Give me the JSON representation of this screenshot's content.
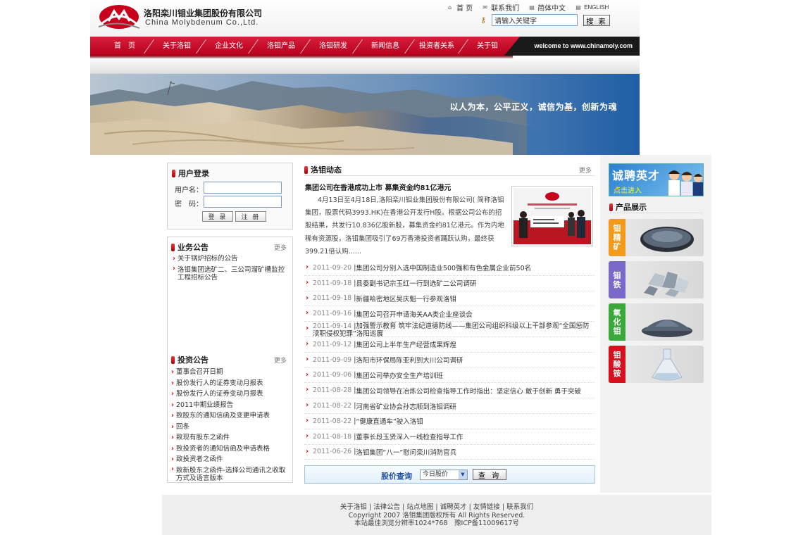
{
  "header": {
    "company_cn": "洛阳栾川钼业集团股份有限公司",
    "company_en": "China Molybdenum Co.,Ltd.",
    "top_links": {
      "home": "首 页",
      "contact": "联系我们",
      "simplified": "简体中文",
      "english": "ENGLISH"
    },
    "search": {
      "value": "请输入关键字",
      "button": "搜 索"
    }
  },
  "nav": {
    "items": [
      "首　页",
      "关于洛钼",
      "企业文化",
      "洛钼产品",
      "洛钼研发",
      "新闻信息",
      "投资者关系",
      "关于钼"
    ],
    "welcome": "welcome to www.chinamoly.com"
  },
  "banner": {
    "slogan": "以人为本，公平正义，诚信为基，创新为魂"
  },
  "login": {
    "title": "用户登录",
    "username_label": "用户名：",
    "password_label": "密　码：",
    "login_button": "登 录",
    "register_button": "注 册"
  },
  "business_notice": {
    "title": "业务公告",
    "more": "更多",
    "items": [
      "关于锅炉招标的公告",
      "洛钼集团选矿二、三公司溜矿槽监控工程招标公告"
    ]
  },
  "investor_notice": {
    "title": "投资公告",
    "more": "更多",
    "items": [
      "董事会召开日期",
      "股份发行人的证券变动月报表",
      "股份发行人的证券变动月报表",
      "2011中期业绩报告",
      "致股东的通知信函及变更申请表",
      "回条",
      "致现有股东之函件",
      "致投资者的通知信函及申请表格",
      "致投资者之函件",
      "致新股东之函件-选择公司通讯之收取方式及语言版本"
    ]
  },
  "news": {
    "title": "洛钼动态",
    "more": "更多",
    "headline": "集团公司在香港成功上市 募集资金约81亿港元",
    "summary": "4月13日至4月18日,洛阳栾川钼业集团股份有限公司( 简称洛钼集团，股票代码3993.HK)在香港公开发行H股。根据公司公布的招股结果，共发行10.836亿股新股，募集资金约81亿港元。作为内地稀有资源股，洛钼集团吸引了69万香港投资者踊跃认购，最终获399.21倍认购......",
    "items": [
      {
        "date": "2011-09-20",
        "text": "集团公司分别入选中国制造业500强和有色金属企业前50名"
      },
      {
        "date": "2011-09-18",
        "text": "县委副书记宗玉红一行到选矿二公司调研"
      },
      {
        "date": "2011-09-18",
        "text": "新疆哈密地区吴庆魁一行参观洛钼"
      },
      {
        "date": "2011-09-16",
        "text": "集团公司召开申请海关AA类企业座谈会"
      },
      {
        "date": "2011-09-14",
        "text": "加强警示教育 筑牢法纪道德防线——集团公司组织科级以上干部参观“全国惩防渎职侵权犯罪”洛阳巡展"
      },
      {
        "date": "2011-09-12",
        "text": "集团公司上半年生产经营成果辉煌"
      },
      {
        "date": "2011-09-09",
        "text": "洛阳市环保局陈亚利到大川公司调研"
      },
      {
        "date": "2011-09-06",
        "text": "集团公司举办安全生产培训班"
      },
      {
        "date": "2011-08-28",
        "text": "集团公司领导在冶炼公司检查指导工作时指出：坚定信心 敢于创新 勇于突破"
      },
      {
        "date": "2011-08-22",
        "text": "河南省矿业协会孙志顺到洛钼调研"
      },
      {
        "date": "2011-08-22",
        "text": "“健康直通车”驶入洛钼"
      },
      {
        "date": "2011-08-18",
        "text": "董事长段玉贤深入一线检查指导工作"
      },
      {
        "date": "2011-06-26",
        "text": "洛钼集团“八一”慰问栾川消防官兵"
      }
    ]
  },
  "stock": {
    "label": "股价查询",
    "select_value": "今日股价",
    "button": "查 询"
  },
  "recruit": {
    "big": "诚聘英才",
    "small": "点击进入"
  },
  "products": {
    "title": "产品展示",
    "items": [
      {
        "name": "钼精矿",
        "color": "#f39a1a"
      },
      {
        "name": "钼铁",
        "color": "#7a69c8"
      },
      {
        "name": "氧化钼",
        "color": "#3aa83a"
      },
      {
        "name": "钼酸铵",
        "color": "#d8101e"
      }
    ]
  },
  "footer": {
    "links": "关于洛钼 | 法律公告 | 站点地图 | 诚聘英才 | 友情链接 | 联系我们",
    "copyright": "Copyright 2007 洛钼集团版权所有 All Rights Reserved.",
    "info": "本站最佳浏览分辨率1024*768　豫ICP备11009617号"
  },
  "colors": {
    "brand_red": "#c8001e",
    "link_blue": "#1d4e9c"
  }
}
